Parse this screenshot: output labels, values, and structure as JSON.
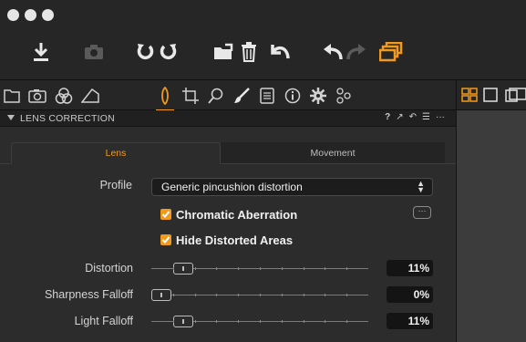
{
  "colors": {
    "accent": "#f29a1c",
    "panel_bg": "#2c2c2c",
    "toolbar_bg": "#262626",
    "viewer_bg": "#3c3c3c"
  },
  "window": {
    "traffic_lights": [
      "close",
      "minimize",
      "zoom"
    ]
  },
  "toolbar": {
    "buttons": [
      "import-icon",
      "camera-icon",
      "rotate-left-icon",
      "rotate-right-icon",
      "move-folder-icon",
      "trash-icon",
      "reset-icon",
      "undo-icon",
      "redo-icon",
      "stack-icon"
    ]
  },
  "tool_tabs": {
    "icons": [
      "folder-icon",
      "camera-icon",
      "color-balance-icon",
      "exposure-icon",
      "lens-icon",
      "crop-icon",
      "search-icon",
      "brush-icon",
      "list-icon",
      "info-icon",
      "gear-icon",
      "sliders-icon"
    ],
    "active_index": 4
  },
  "view_modes": [
    "grid-view-icon",
    "single-view-icon",
    "compare-view-icon"
  ],
  "panel": {
    "title": "LENS CORRECTION",
    "header_icons": {
      "help": "?",
      "copy": "↗",
      "reset": "↶",
      "menu": "☰",
      "more": "···"
    },
    "tabs": [
      "Lens",
      "Movement"
    ],
    "active_tab": "Lens",
    "profile": {
      "label": "Profile",
      "value": "Generic pincushion distortion"
    },
    "checkboxes": [
      {
        "label": "Chromatic Aberration",
        "checked": true
      },
      {
        "label": "Hide Distorted Areas",
        "checked": true
      }
    ],
    "more_button": "···",
    "sliders": [
      {
        "label": "Distortion",
        "value": "11%",
        "fraction": 0.11
      },
      {
        "label": "Sharpness Falloff",
        "value": "0%",
        "fraction": 0.0
      },
      {
        "label": "Light Falloff",
        "value": "11%",
        "fraction": 0.11
      }
    ]
  }
}
